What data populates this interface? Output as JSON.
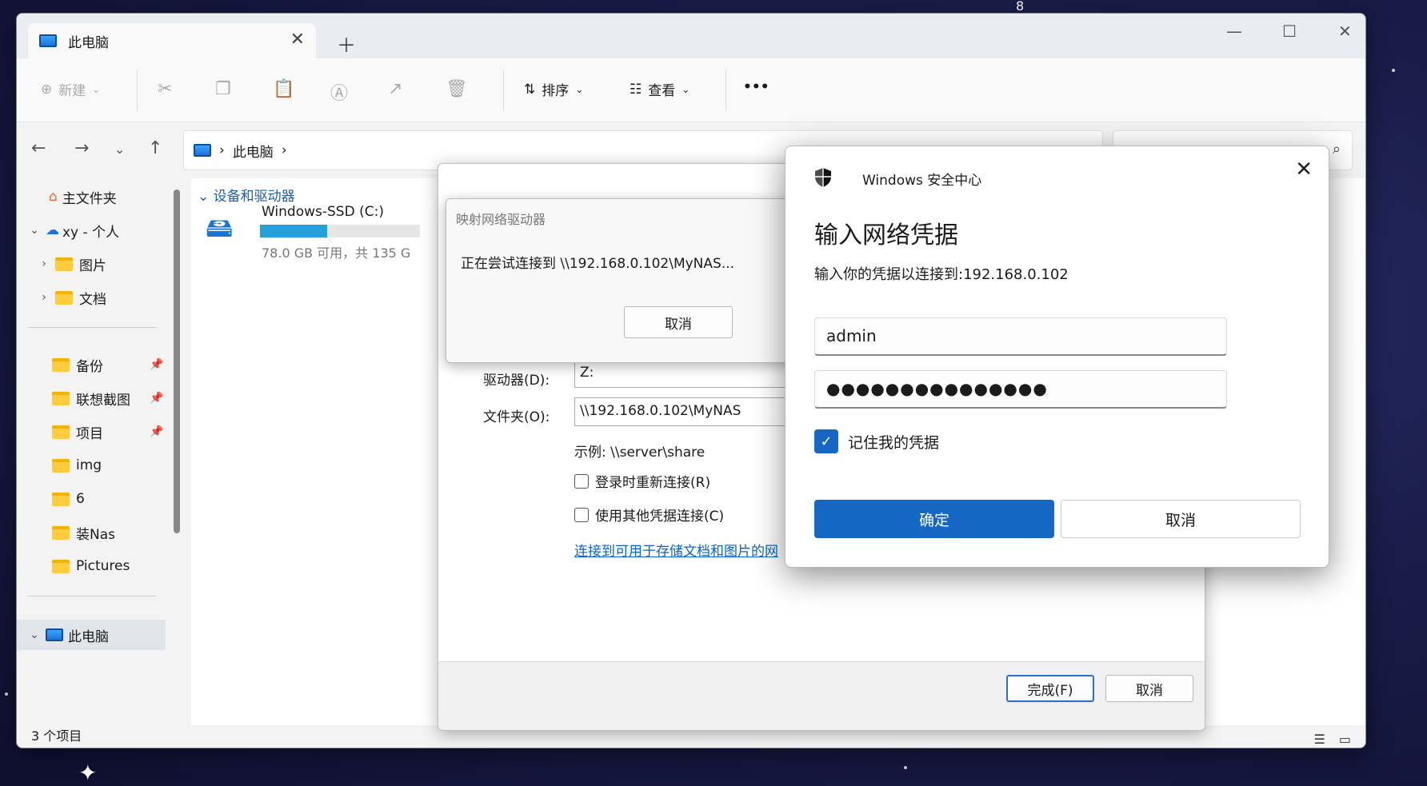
{
  "desktop": {
    "number": "8"
  },
  "tab": {
    "title": "此电脑"
  },
  "toolbar": {
    "new_label": "新建",
    "sort_label": "排序",
    "view_label": "查看",
    "more_label": "•••"
  },
  "address": {
    "crumb": "此电脑"
  },
  "sidebar": {
    "home": "主文件夹",
    "onedrive": "xy - 个人",
    "pictures": "图片",
    "documents": "文档",
    "pinned": [
      "备份",
      "联想截图",
      "项目"
    ],
    "folders": [
      "img",
      "6",
      "装Nas",
      "Pictures"
    ],
    "thispc": "此电脑"
  },
  "content": {
    "group": "设备和驱动器",
    "drive_name": "Windows-SSD (C:)",
    "drive_free": "78.0 GB 可用，共 135 G",
    "drive_used_fraction": 0.42
  },
  "status": {
    "count": "3 个项目"
  },
  "map_dialog": {
    "drive_label": "驱动器(D):",
    "drive_value": "Z:",
    "folder_label": "文件夹(O):",
    "folder_value": "\\\\192.168.0.102\\MyNAS",
    "example": "示例: \\\\server\\share",
    "reconnect": "登录时重新连接(R)",
    "other_creds": "使用其他凭据连接(C)",
    "link": "连接到可用于存储文档和图片的网",
    "finish": "完成(F)",
    "cancel": "取消"
  },
  "connecting_dialog": {
    "title": "映射网络驱动器",
    "message": "正在尝试连接到 \\\\192.168.0.102\\MyNAS...",
    "cancel": "取消"
  },
  "security_dialog": {
    "app": "Windows 安全中心",
    "heading": "输入网络凭据",
    "subtitle": "输入你的凭据以连接到:192.168.0.102",
    "username": "admin",
    "password": "●●●●●●●●●●●●●●●",
    "remember": "记住我的凭据",
    "ok": "确定",
    "cancel": "取消"
  },
  "colors": {
    "accent": "#1667c4",
    "link": "#0a64c8"
  }
}
